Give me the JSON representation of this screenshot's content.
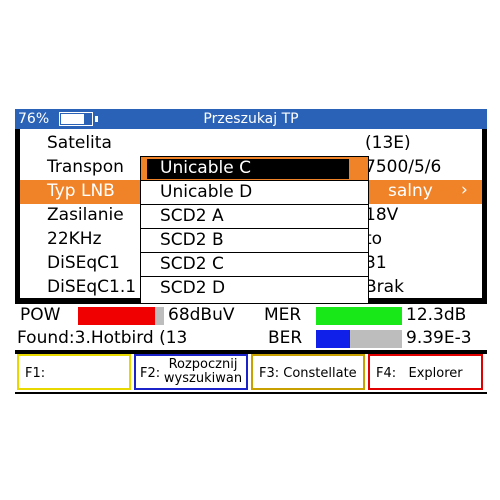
{
  "header": {
    "battery": "76%",
    "battery_level": 0.76,
    "title": "Przeszukaj TP"
  },
  "settings": {
    "rows": [
      {
        "label": "Satelita",
        "value": "(13E)"
      },
      {
        "label": "Transpon",
        "value": "7500/5/6"
      },
      {
        "label": "Typ LNB",
        "value": "salny",
        "selected": true
      },
      {
        "label": "Zasilanie",
        "value": "18V"
      },
      {
        "label": "22KHz",
        "value": "to"
      },
      {
        "label": "DiSEqC1",
        "value": "31"
      },
      {
        "label": "DiSEqC1.1",
        "value": "Brak"
      }
    ]
  },
  "dropdown": {
    "options": [
      "Unicable C",
      "Unicable D",
      "SCD2 A",
      "SCD2 B",
      "SCD2 C",
      "SCD2 D"
    ],
    "selected_index": 0
  },
  "signal": {
    "pow": {
      "label": "POW",
      "value": "68dBuV",
      "level": 0.9,
      "color": "#f00000"
    },
    "mer": {
      "label": "MER",
      "value": "12.3dB",
      "level": 1.0,
      "color": "#18e818"
    },
    "ber": {
      "label": "BER",
      "value": "9.39E-3",
      "level": 0.4,
      "color": "#1020e8"
    },
    "found": "Found:3.Hotbird (13"
  },
  "function_keys": [
    {
      "label": "F1:",
      "color": "#e8d800"
    },
    {
      "label": "F2:",
      "text": "Rozpocznij wyszukiwan",
      "color": "#1a22c8"
    },
    {
      "label": "F3: Constellate",
      "color": "#c8a000"
    },
    {
      "label": "F4:   Explorer",
      "color": "#e00000"
    }
  ],
  "colors": {
    "header_bg": "#2a62b8",
    "accent": "#f08228"
  }
}
